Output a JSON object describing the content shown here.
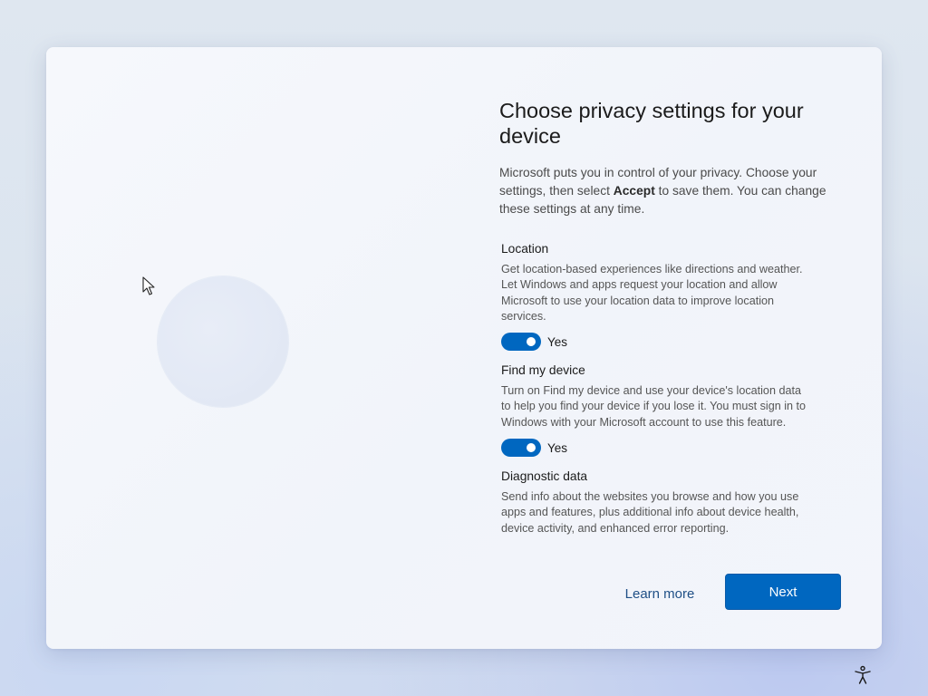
{
  "page": {
    "title": "Choose privacy settings for your device",
    "intro_before": "Microsoft puts you in control of your privacy. Choose your settings, then select ",
    "intro_bold": "Accept",
    "intro_after": " to save them. You can change these settings at any time."
  },
  "settings": [
    {
      "title": "Location",
      "description": "Get location-based experiences like directions and weather. Let Windows and apps request your location and allow Microsoft to use your location data to improve location services.",
      "toggle_on": true,
      "toggle_label": "Yes"
    },
    {
      "title": "Find my device",
      "description": "Turn on Find my device and use your device's location data to help you find your device if you lose it. You must sign in to Windows with your Microsoft account to use this feature.",
      "toggle_on": true,
      "toggle_label": "Yes"
    },
    {
      "title": "Diagnostic data",
      "description": "Send info about the websites you browse and how you use apps and features, plus additional info about device health, device activity, and enhanced error reporting."
    }
  ],
  "buttons": {
    "learn_more": "Learn more",
    "next": "Next"
  },
  "icons": {
    "accessibility": "accessibility-icon",
    "cursor": "mouse-cursor-icon"
  },
  "colors": {
    "accent": "#0067c0",
    "link": "#1f4f86"
  }
}
